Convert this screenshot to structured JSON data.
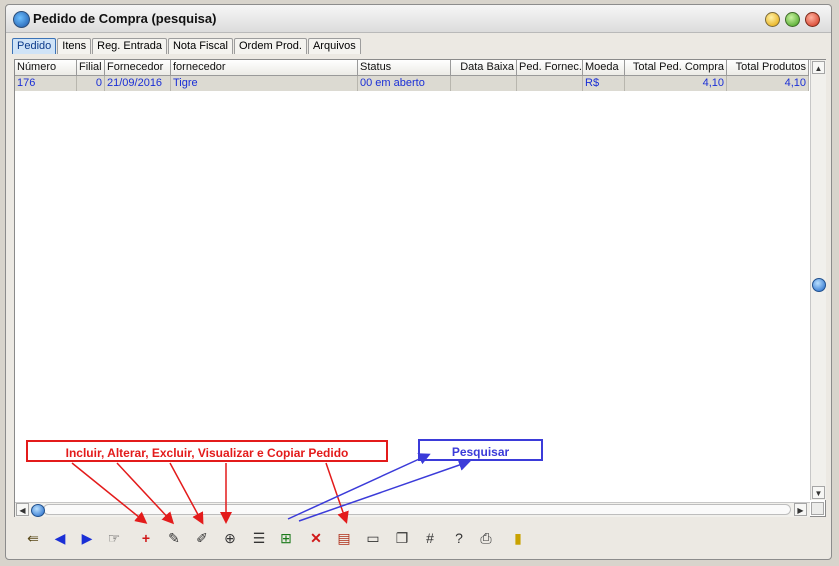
{
  "window": {
    "title": "Pedido de Compra  (pesquisa)"
  },
  "tabs": [
    "Pedido",
    "Itens",
    "Reg. Entrada",
    "Nota Fiscal",
    "Ordem Prod.",
    "Arquivos"
  ],
  "grid": {
    "columns": [
      "Número",
      "Filial",
      "Fornecedor",
      "fornecedor",
      "Status",
      "Data Baixa",
      "Ped. Fornec.",
      "Moeda",
      "Total Ped. Compra",
      "Total Produtos"
    ],
    "rows": [
      [
        "176",
        "0",
        "21/09/2016",
        "Tigre",
        "00 em aberto",
        "",
        "",
        "R$",
        "4,10",
        "4,10"
      ]
    ]
  },
  "annotations": {
    "red": "Incluir, Alterar, Excluir, Visualizar e Copiar Pedido",
    "blue": "Pesquisar"
  },
  "colors": {
    "row_text": "#1a2fd6",
    "annotation_red": "#e31b1b",
    "annotation_blue": "#3b3bd9",
    "active_tab": "#cfe3f7"
  },
  "toolbar_icons": [
    "exit-icon",
    "previous-icon",
    "next-icon",
    "hand-pointer-icon",
    "insert-icon",
    "edit-icon",
    "delete-icon",
    "view-icon",
    "copy-order-icon",
    "search-icon",
    "cancel-icon",
    "document-icon",
    "card-icon",
    "pages-icon",
    "hash-icon",
    "help-icon",
    "print-icon",
    "exit-door-icon"
  ]
}
